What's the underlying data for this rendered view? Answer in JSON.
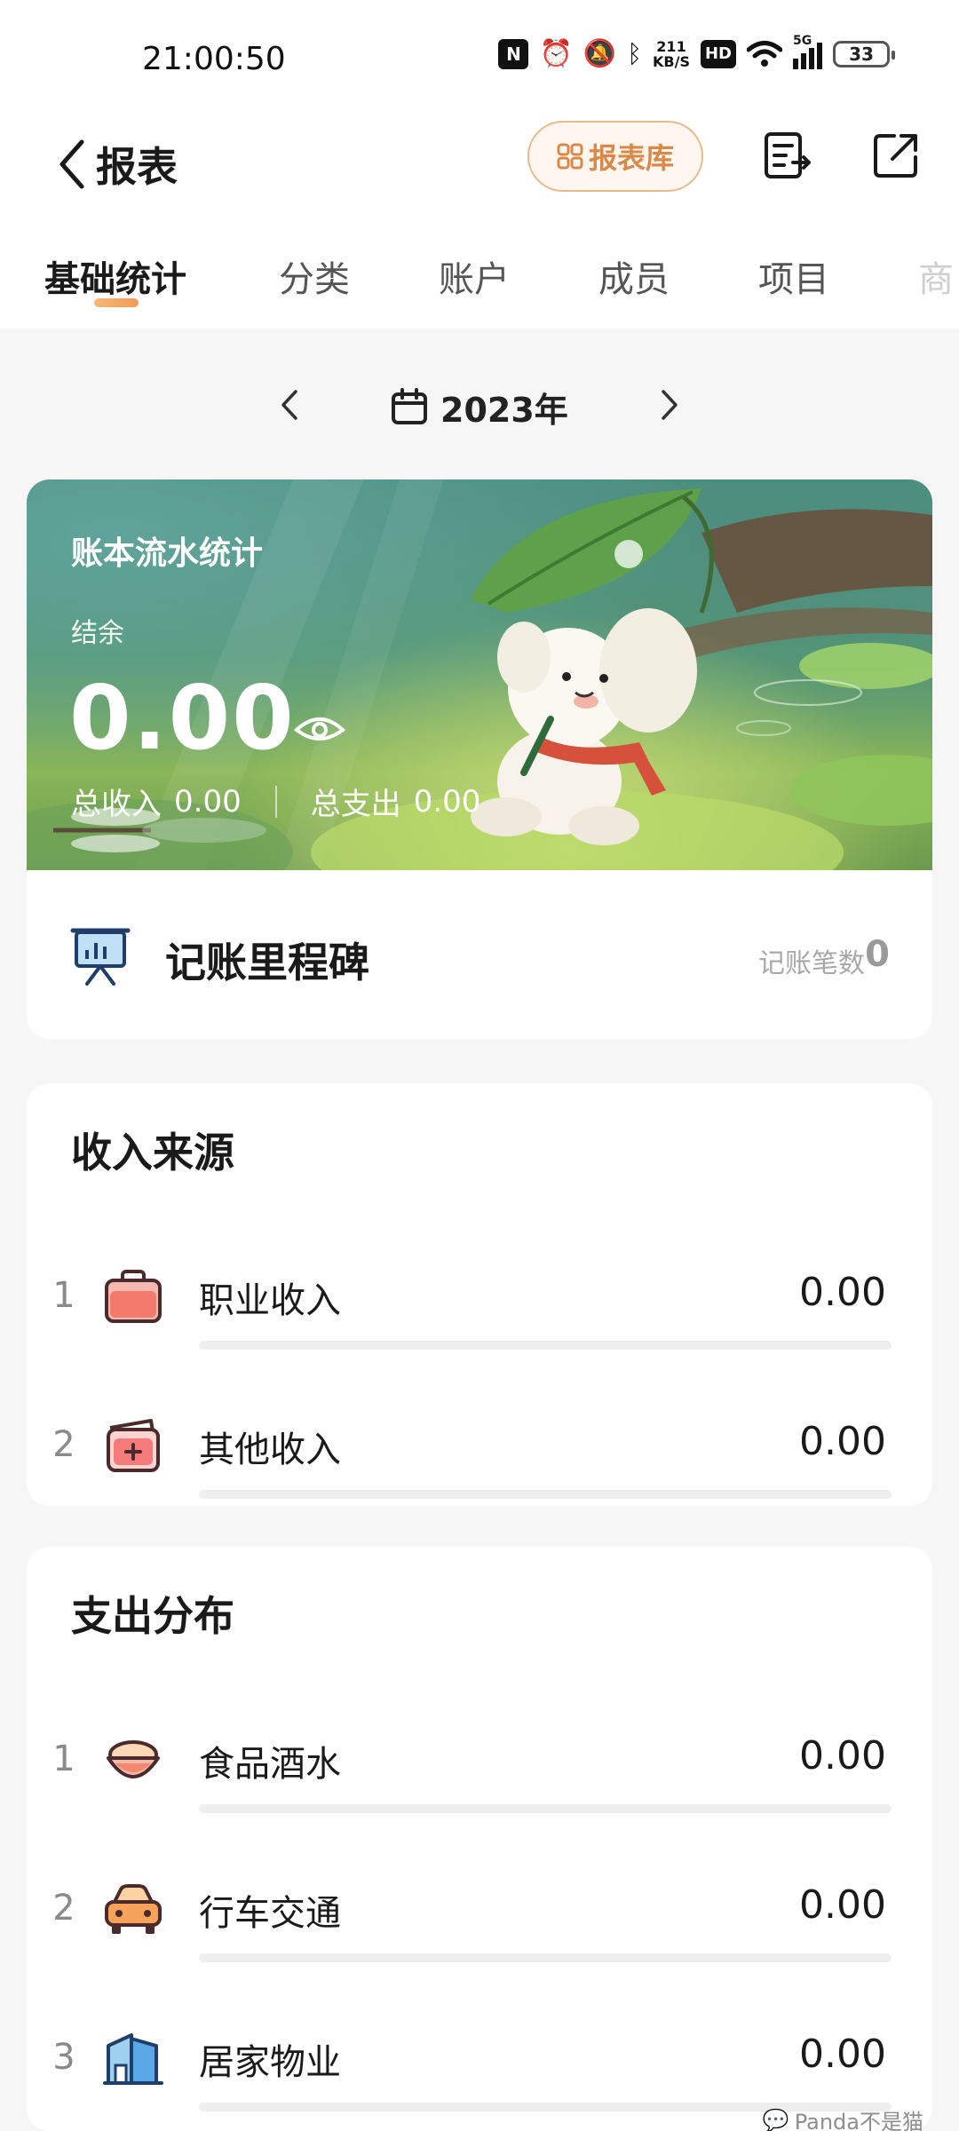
{
  "status_bar": {
    "time": "21:00:50",
    "network_speed_value": "211",
    "network_speed_unit": "KB/S",
    "hd_label": "HD",
    "signal_label": "5G",
    "battery": "33",
    "icons": [
      "nfc-icon",
      "alarm-icon",
      "mute-icon",
      "bluetooth-icon",
      "wifi-icon",
      "signal-icon",
      "battery-icon"
    ]
  },
  "header": {
    "title": "报表",
    "report_library_label": "报表库"
  },
  "tabs": {
    "items": [
      {
        "label": "基础统计",
        "active": true
      },
      {
        "label": "分类",
        "active": false
      },
      {
        "label": "账户",
        "active": false
      },
      {
        "label": "成员",
        "active": false
      },
      {
        "label": "项目",
        "active": false
      },
      {
        "label": "商",
        "active": false
      }
    ]
  },
  "year_selector": {
    "year_label": "2023年"
  },
  "banner": {
    "title": "账本流水统计",
    "balance_label": "结余",
    "balance_value": "0.00",
    "income_label": "总收入",
    "income_value": "0.00",
    "expense_label": "总支出",
    "expense_value": "0.00"
  },
  "milestone": {
    "title": "记账里程碑",
    "count_label": "记账笔数",
    "count_value": "0"
  },
  "income_sources": {
    "title": "收入来源",
    "items": [
      {
        "rank": "1",
        "name": "职业收入",
        "amount": "0.00",
        "icon": "briefcase-icon"
      },
      {
        "rank": "2",
        "name": "其他收入",
        "amount": "0.00",
        "icon": "wallet-plus-icon"
      }
    ]
  },
  "expense_distribution": {
    "title": "支出分布",
    "items": [
      {
        "rank": "1",
        "name": "食品酒水",
        "amount": "0.00",
        "icon": "food-bowl-icon"
      },
      {
        "rank": "2",
        "name": "行车交通",
        "amount": "0.00",
        "icon": "car-icon"
      },
      {
        "rank": "3",
        "name": "居家物业",
        "amount": "0.00",
        "icon": "building-icon"
      }
    ]
  },
  "watermark": "Panda不是猫",
  "colors": {
    "accent_orange": "#d9894a",
    "tab_underline": "#f29a58",
    "banner_green": "#5a9a70"
  }
}
